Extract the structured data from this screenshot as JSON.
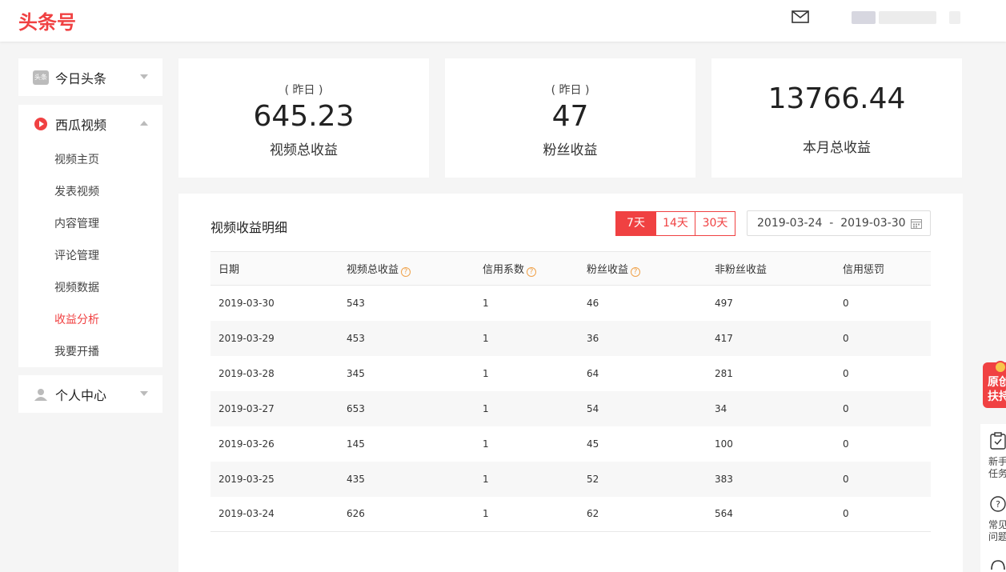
{
  "header": {
    "logo": "头条号"
  },
  "sidebar": {
    "toutiao": {
      "label": "今日头条",
      "icon_text": "头条"
    },
    "xigua": {
      "label": "西瓜视频",
      "items": [
        {
          "label": "视频主页"
        },
        {
          "label": "发表视频"
        },
        {
          "label": "内容管理"
        },
        {
          "label": "评论管理"
        },
        {
          "label": "视频数据"
        },
        {
          "label": "收益分析",
          "active": true
        },
        {
          "label": "我要开播"
        }
      ]
    },
    "personal": {
      "label": "个人中心"
    }
  },
  "stats": [
    {
      "sub": "( 昨日 )",
      "value": "645.23",
      "label": "视频总收益"
    },
    {
      "sub": "( 昨日 )",
      "value": "47",
      "label": "粉丝收益"
    },
    {
      "sub": "",
      "value": "13766.44",
      "label": "本月总收益"
    }
  ],
  "panel": {
    "title": "视频收益明细",
    "ranges": [
      "7天",
      "14天",
      "30天"
    ],
    "selected_range": "7天",
    "date_range": "2019-03-24  -  2019-03-30"
  },
  "table": {
    "headers": [
      "日期",
      "视频总收益",
      "信用系数",
      "粉丝收益",
      "非粉丝收益",
      "信用惩罚"
    ],
    "rows": [
      [
        "2019-03-30",
        "543",
        "1",
        "46",
        "497",
        "0"
      ],
      [
        "2019-03-29",
        "453",
        "1",
        "36",
        "417",
        "0"
      ],
      [
        "2019-03-28",
        "345",
        "1",
        "64",
        "281",
        "0"
      ],
      [
        "2019-03-27",
        "653",
        "1",
        "54",
        "34",
        "0"
      ],
      [
        "2019-03-26",
        "145",
        "1",
        "45",
        "100",
        "0"
      ],
      [
        "2019-03-25",
        "435",
        "1",
        "52",
        "383",
        "0"
      ],
      [
        "2019-03-24",
        "626",
        "1",
        "62",
        "564",
        "0"
      ]
    ]
  },
  "float": {
    "promo": "原创扶持",
    "help": [
      {
        "label": "新手任务"
      },
      {
        "label": "常见问题"
      }
    ]
  },
  "colors": {
    "accent": "#f04142",
    "help_icon": "#f0a24a"
  }
}
